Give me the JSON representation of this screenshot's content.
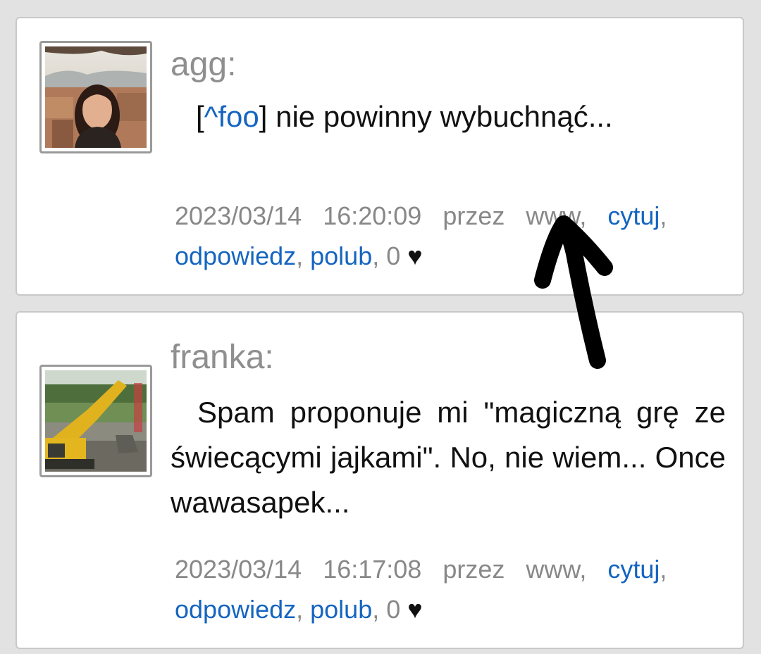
{
  "comments": [
    {
      "author": "agg:",
      "body_prefix": "[",
      "body_link": "^foo",
      "body_suffix": "] nie powinny wybuchnąć...",
      "date": "2023/03/14",
      "time": "16:20:09",
      "przez": "przez",
      "www": "www,",
      "quote_label": "cytuj",
      "reply_label": "odpowiedz",
      "like_label": "polub",
      "like_count": "0",
      "heart": "♥"
    },
    {
      "author": "franka:",
      "body": "Spam proponuje mi \"magiczną grę ze świecącymi jajkami\". No, nie wiem... Once wawasapek...",
      "date": "2023/03/14",
      "time": "16:17:08",
      "przez": "przez",
      "www": "www,",
      "quote_label": "cytuj",
      "reply_label": "odpowiedz",
      "like_label": "polub",
      "like_count": "0",
      "heart": "♥"
    }
  ],
  "colors": {
    "link": "#1565c0",
    "meta": "#888888",
    "author": "#8f8f8f",
    "background": "#e2e2e2"
  }
}
